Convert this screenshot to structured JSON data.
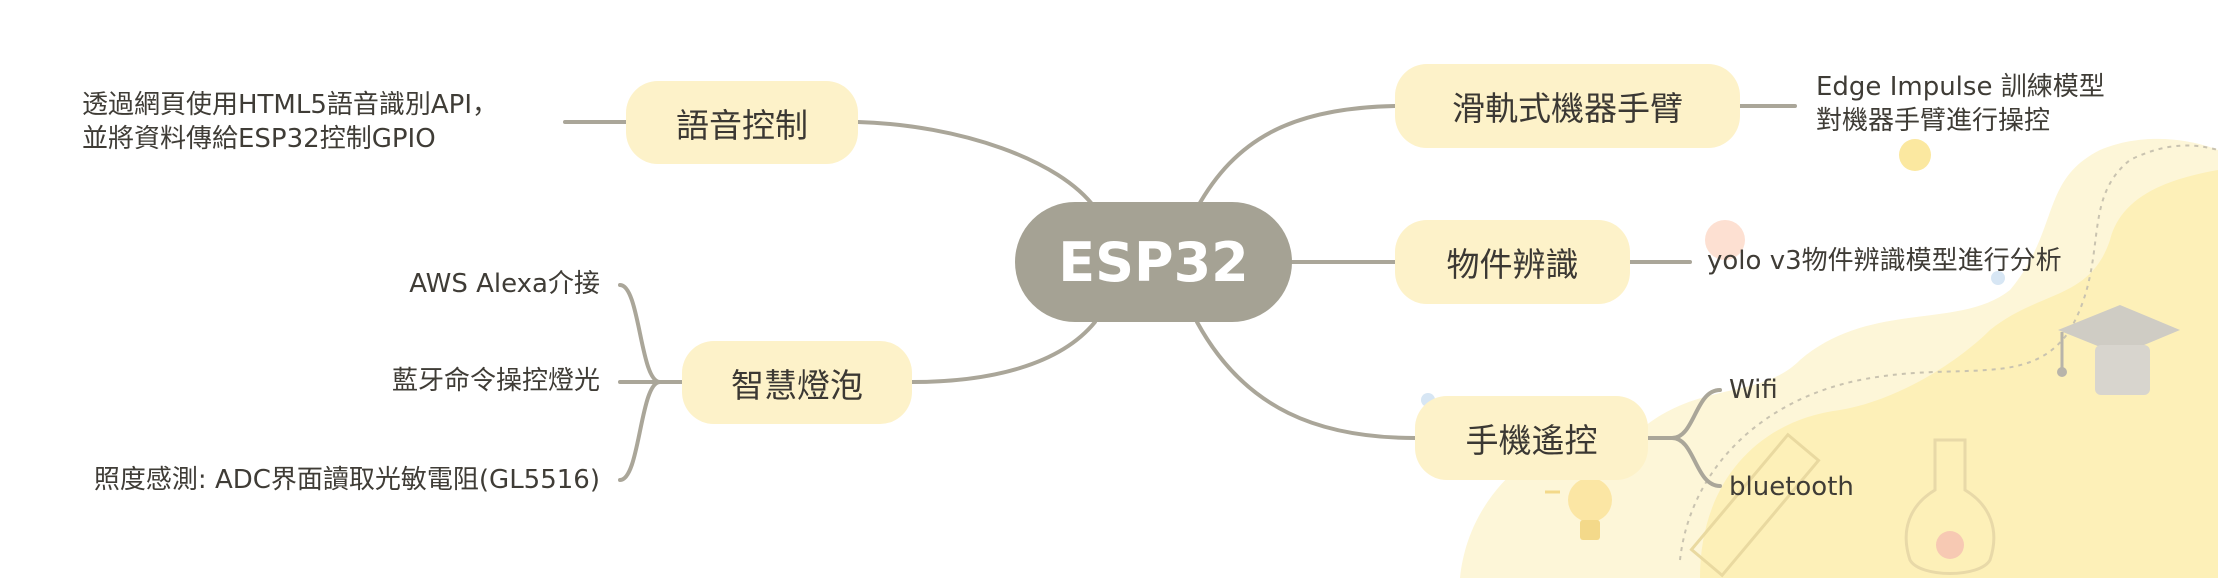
{
  "diagram": {
    "center": "ESP32",
    "branches": {
      "voice": {
        "label": "語音控制",
        "details": [
          "透過網頁使用HTML5語音識別API，",
          "並將資料傳給ESP32控制GPIO"
        ]
      },
      "bulb": {
        "label": "智慧燈泡",
        "details": [
          "AWS Alexa介接",
          "藍牙命令操控燈光",
          "照度感測: ADC界面讀取光敏電阻(GL5516)"
        ]
      },
      "arm": {
        "label": "滑軌式機器手臂",
        "details": [
          "Edge Impulse 訓練模型",
          "對機器手臂進行操控"
        ]
      },
      "object": {
        "label": "物件辨識",
        "details": [
          "yolo v3物件辨識模型進行分析"
        ]
      },
      "phone": {
        "label": "手機遙控",
        "details": [
          "Wifi",
          "bluetooth"
        ]
      }
    }
  },
  "colors": {
    "center_fill": "#a5a294",
    "node_fill": "#fdf2c9",
    "connector": "#aaa699",
    "decor_yellow": "#fdf0b8"
  },
  "decorations": [
    "blob-background",
    "graduation-cap-icon",
    "flask-icon",
    "lightbulb-icon",
    "ruler-icon"
  ]
}
